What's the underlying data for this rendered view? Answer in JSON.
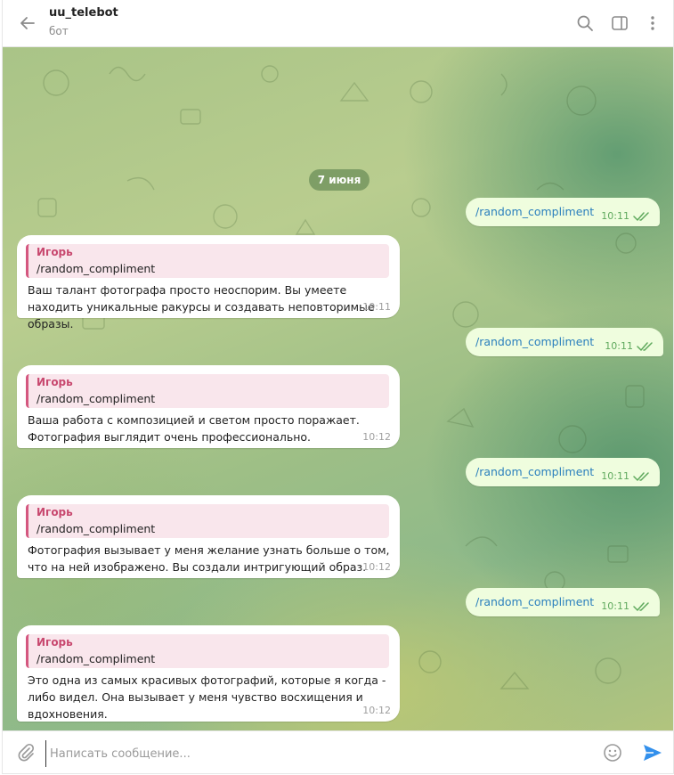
{
  "header": {
    "title": "uu_telebot",
    "subtitle": "бот"
  },
  "date_divider": "7 июня",
  "messages": {
    "outgoing": [
      {
        "text": "/random_compliment",
        "time": "10:11"
      },
      {
        "text": "/random_compliment",
        "time": "10:11"
      },
      {
        "text": "/random_compliment",
        "time": "10:11"
      },
      {
        "text": "/random_compliment",
        "time": "10:11"
      }
    ],
    "incoming": [
      {
        "reply_author": "Игорь",
        "reply_text": "/random_compliment",
        "text": "Ваш талант фотографа просто неоспорим. Вы умеете находить уникальные ракурсы и создавать неповторимые образы.",
        "time": "10:11"
      },
      {
        "reply_author": "Игорь",
        "reply_text": "/random_compliment",
        "text": "Ваша работа с композицией и светом просто поражает. Фотография выглядит очень профессионально.",
        "time": "10:12"
      },
      {
        "reply_author": "Игорь",
        "reply_text": "/random_compliment",
        "text": "Фотография вызывает у меня желание узнать больше о том, что на ней изображено. Вы создали интригующий образ.",
        "time": "10:12"
      },
      {
        "reply_author": "Игорь",
        "reply_text": "/random_compliment",
        "text": "Это одна из самых красивых фотографий, которые я когда - либо видел. Она вызывает у меня чувство восхищения и вдохновения.",
        "time": "10:12"
      }
    ]
  },
  "composer": {
    "placeholder": "Написать сообщение..."
  },
  "icons": {
    "back": "arrow-left-icon",
    "search": "search-icon",
    "panel": "sidebar-toggle-icon",
    "more": "more-vertical-icon",
    "attach": "paperclip-icon",
    "emoji": "emoji-icon",
    "send": "send-icon",
    "read": "double-check-icon"
  },
  "colors": {
    "accent": "#3390ec",
    "outgoing_bubble": "#effdde",
    "outgoing_time": "#5fa95d",
    "reply_author": "#c8486f",
    "reply_bg": "#f9e6ec",
    "command_link": "#2a7fbd"
  }
}
